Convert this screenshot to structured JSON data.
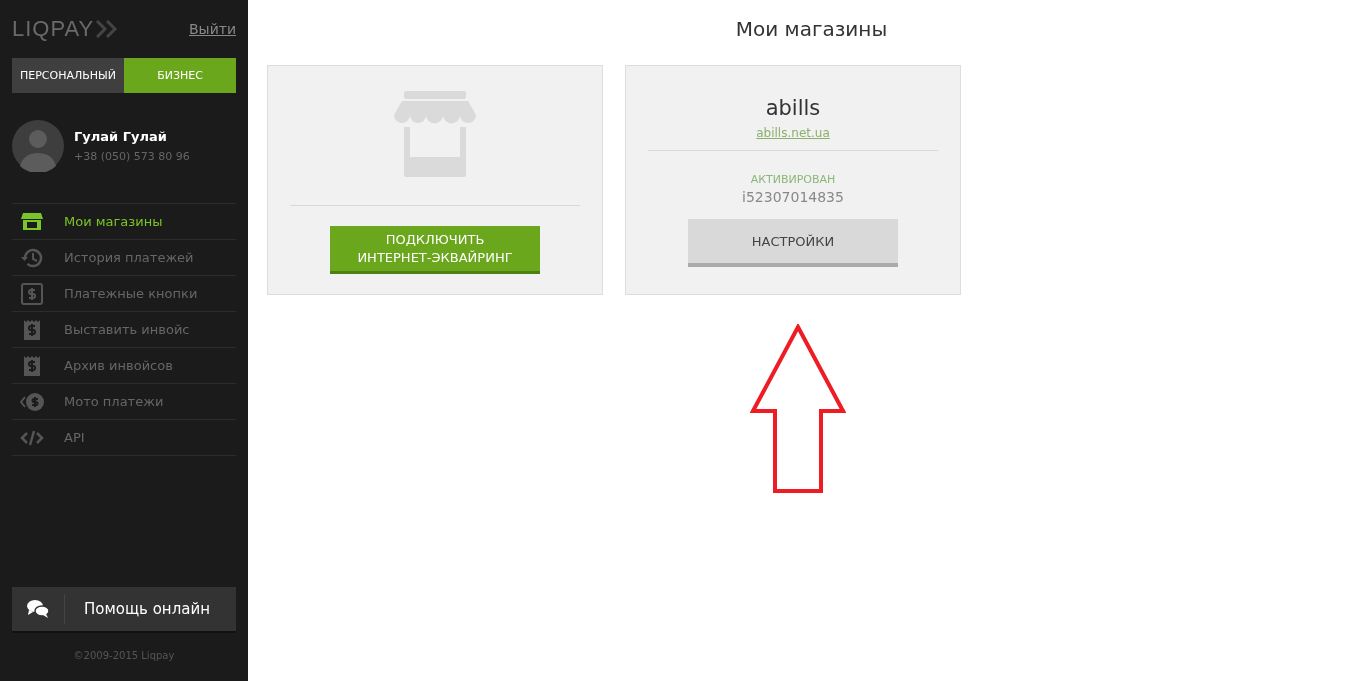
{
  "sidebar": {
    "logo": "LIQPAY",
    "logout": "Выйти",
    "tabs": [
      {
        "label": "ПЕРСОНАЛЬНЫЙ",
        "selected": false
      },
      {
        "label": "БИЗНЕС",
        "selected": true
      }
    ],
    "user": {
      "name": "Гулай Гулай",
      "phone": "+38 (050) 573 80 96"
    },
    "menu": [
      {
        "label": "Мои магазины",
        "selected": true
      },
      {
        "label": "История платежей",
        "selected": false
      },
      {
        "label": "Платежные кнопки",
        "selected": false
      },
      {
        "label": "Выставить инвойс",
        "selected": false
      },
      {
        "label": "Архив инвойсов",
        "selected": false
      },
      {
        "label": "Мото платежи",
        "selected": false
      },
      {
        "label": "API",
        "selected": false
      }
    ],
    "help_button": "Помощь онлайн",
    "copyright": "©2009-2015 Liqpay"
  },
  "main": {
    "title": "Мои магазины",
    "cards": [
      {
        "kind": "new",
        "button": "ПОДКЛЮЧИТЬ ИНТЕРНЕТ-ЭКВАЙРИНГ"
      },
      {
        "kind": "shop",
        "name": "abills",
        "link": "abills.net.ua",
        "status": "АКТИВИРОВАН",
        "id": "i52307014835",
        "button": "НАСТРОЙКИ"
      }
    ]
  }
}
